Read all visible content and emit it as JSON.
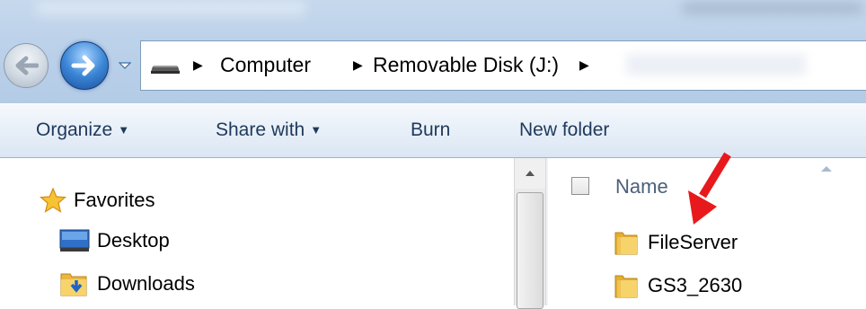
{
  "window": {
    "address": {
      "crumbs": [
        "Computer",
        "Removable Disk (J:)"
      ]
    }
  },
  "toolbar": {
    "organize_label": "Organize",
    "share_label": "Share with",
    "burn_label": "Burn",
    "new_folder_label": "New folder"
  },
  "nav": {
    "favorites": "Favorites",
    "items": [
      {
        "label": "Desktop",
        "icon": "desktop-icon"
      },
      {
        "label": "Downloads",
        "icon": "downloads-folder-icon"
      }
    ]
  },
  "files": {
    "column_name": "Name",
    "rows": [
      {
        "name": "FileServer",
        "icon": "folder-icon"
      },
      {
        "name": "GS3_2630",
        "icon": "folder-icon"
      }
    ]
  },
  "colors": {
    "accent": "#1e395b",
    "annotation_arrow": "#e8191c",
    "folder": "#f2c94c"
  }
}
